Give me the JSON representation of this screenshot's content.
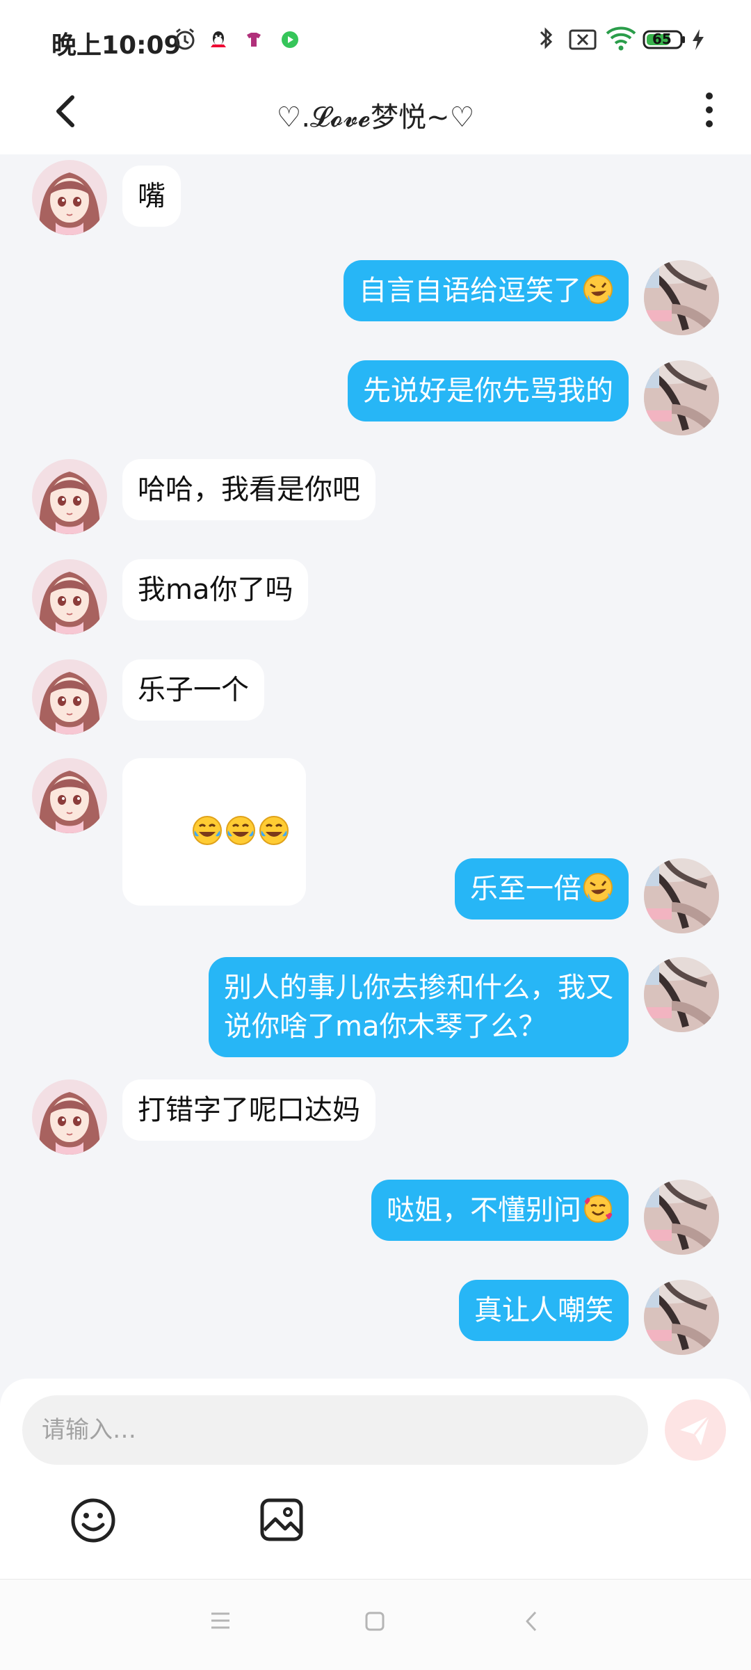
{
  "status_bar": {
    "time": "晚上10:09",
    "battery_level": "65",
    "icons": [
      "alarm-icon",
      "qq-icon",
      "app-shirt-icon",
      "app-play-icon",
      "bluetooth-icon",
      "sim-off-icon",
      "wifi-icon",
      "battery-icon",
      "charging-icon"
    ]
  },
  "header": {
    "title": "♡.𝓛𝓸𝓿𝓮梦悦~♡",
    "back_icon": "back-arrow-icon",
    "menu_icon": "more-vertical-icon"
  },
  "messages": [
    {
      "side": "left",
      "text": "嘴"
    },
    {
      "side": "right",
      "text": "自言自语给逗笑了",
      "emoji": "rofl"
    },
    {
      "side": "right",
      "text": "先说好是你先骂我的"
    },
    {
      "side": "left",
      "text": "哈哈，我看是你吧"
    },
    {
      "side": "left",
      "text": "我ma你了吗"
    },
    {
      "side": "left",
      "text": "乐子一个"
    },
    {
      "side": "left",
      "text": "",
      "emoji": "laugh-cry x3"
    },
    {
      "side": "right",
      "text": "乐至一倍",
      "emoji": "rofl"
    },
    {
      "side": "right",
      "text": "别人的事儿你去掺和什么，我又\n说你啥了ma你木琴了么？"
    },
    {
      "side": "left",
      "text": "打错字了呢口达妈"
    },
    {
      "side": "right",
      "text": "哒姐，不懂别问",
      "emoji": "smiling-hearts"
    },
    {
      "side": "right",
      "text": "真让人嘲笑"
    }
  ],
  "composer": {
    "placeholder": "请输入…",
    "send_icon": "send-icon",
    "tools": [
      "emoji-icon",
      "image-icon"
    ]
  },
  "nav_bar": {
    "icons": [
      "recent-apps-icon",
      "home-icon",
      "back-icon"
    ]
  },
  "colors": {
    "bubble_self": "#27b6f6",
    "bubble_other": "#ffffff",
    "background": "#f4f5f8",
    "send_disabled": "#fde4e4"
  }
}
